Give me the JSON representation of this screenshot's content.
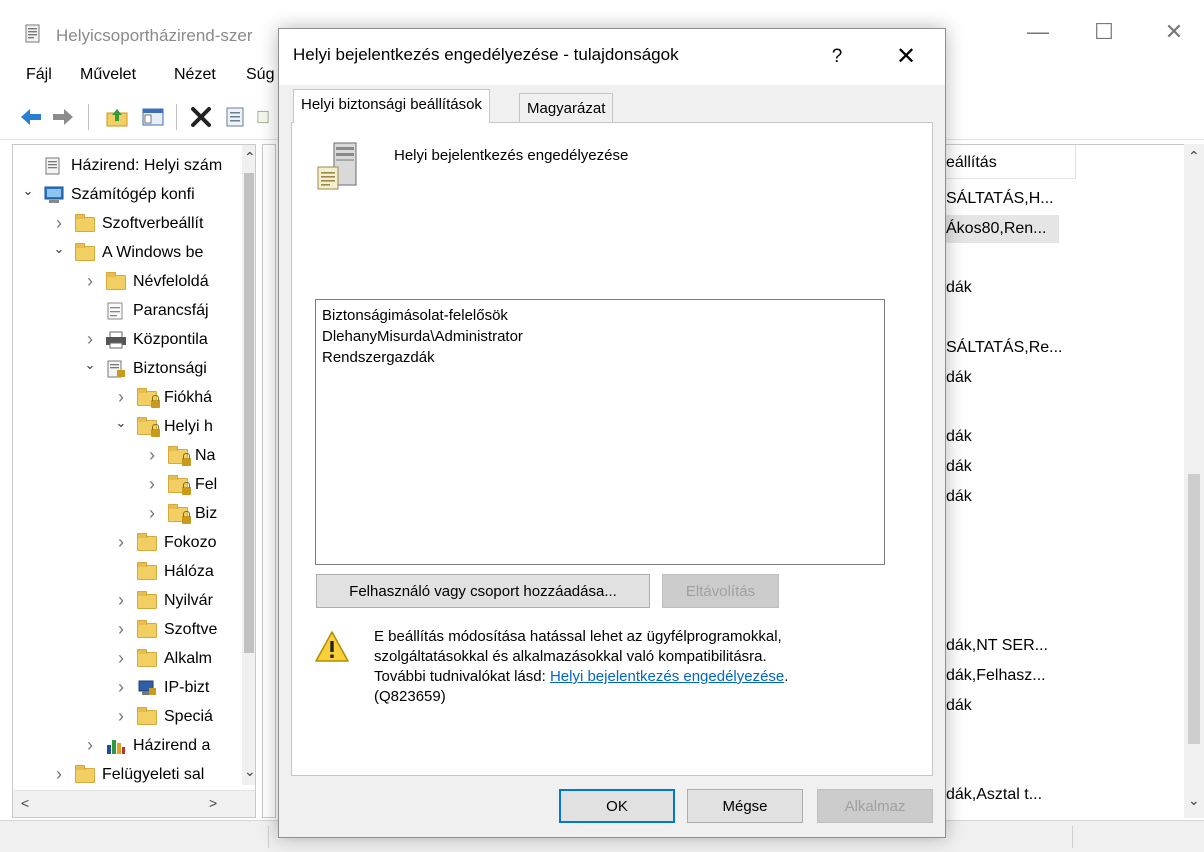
{
  "background_window": {
    "title": "Helyicsoportházirend-szer",
    "menu": [
      "Fájl",
      "Művelet",
      "Nézet",
      "Súg"
    ],
    "tree": [
      {
        "label": "Házirend: Helyi szám",
        "level": 0,
        "chevron": "",
        "icon": "policy-doc"
      },
      {
        "label": "Számítógép konfi",
        "level": 0,
        "chevron": "open",
        "icon": "computer"
      },
      {
        "label": "Szoftverbeállít",
        "level": 1,
        "chevron": "closed",
        "icon": "folder"
      },
      {
        "label": "A Windows be",
        "level": 1,
        "chevron": "open",
        "icon": "folder"
      },
      {
        "label": "Névfeloldá",
        "level": 2,
        "chevron": "closed",
        "icon": "folder"
      },
      {
        "label": "Parancsfáj",
        "level": 2,
        "chevron": "",
        "icon": "script"
      },
      {
        "label": "Központila",
        "level": 2,
        "chevron": "closed",
        "icon": "printer"
      },
      {
        "label": "Biztonsági",
        "level": 2,
        "chevron": "open",
        "icon": "security"
      },
      {
        "label": "Fiókhá",
        "level": 3,
        "chevron": "closed",
        "icon": "folder-lock"
      },
      {
        "label": "Helyi h",
        "level": 3,
        "chevron": "open",
        "icon": "folder-lock"
      },
      {
        "label": "Na",
        "level": 4,
        "chevron": "closed",
        "icon": "folder-lock"
      },
      {
        "label": "Fel",
        "level": 4,
        "chevron": "closed",
        "icon": "folder-lock"
      },
      {
        "label": "Biz",
        "level": 4,
        "chevron": "closed",
        "icon": "folder-lock"
      },
      {
        "label": "Fokozo",
        "level": 3,
        "chevron": "closed",
        "icon": "folder"
      },
      {
        "label": "Hálóza",
        "level": 3,
        "chevron": "",
        "icon": "folder"
      },
      {
        "label": "Nyilvár",
        "level": 3,
        "chevron": "closed",
        "icon": "folder"
      },
      {
        "label": "Szoftve",
        "level": 3,
        "chevron": "closed",
        "icon": "folder"
      },
      {
        "label": "Alkalm",
        "level": 3,
        "chevron": "closed",
        "icon": "folder"
      },
      {
        "label": "IP-bizt",
        "level": 3,
        "chevron": "closed",
        "icon": "ipsec"
      },
      {
        "label": "Speciá",
        "level": 3,
        "chevron": "closed",
        "icon": "folder"
      },
      {
        "label": "Házirend a",
        "level": 2,
        "chevron": "closed",
        "icon": "chart"
      },
      {
        "label": "Felügyeleti sal",
        "level": 1,
        "chevron": "closed",
        "icon": "folder"
      }
    ],
    "right_column_header": "eállítás",
    "right_column_values": [
      {
        "text": "SÁLTATÁS,H...",
        "selected": false
      },
      {
        "text": "Ákos80,Ren...",
        "selected": true
      },
      {
        "text": "",
        "selected": false
      },
      {
        "text": "dák",
        "selected": false
      },
      {
        "text": "",
        "selected": false
      },
      {
        "text": "SÁLTATÁS,Re...",
        "selected": false
      },
      {
        "text": "dák",
        "selected": false
      },
      {
        "text": "",
        "selected": false
      },
      {
        "text": "dák",
        "selected": false
      },
      {
        "text": "dák",
        "selected": false
      },
      {
        "text": "dák",
        "selected": false
      },
      {
        "text": "",
        "selected": false
      },
      {
        "text": "",
        "selected": false
      },
      {
        "text": "",
        "selected": false
      },
      {
        "text": "",
        "selected": false
      },
      {
        "text": "dák,NT SER...",
        "selected": false
      },
      {
        "text": "dák,Felhasz...",
        "selected": false
      },
      {
        "text": "dák",
        "selected": false
      },
      {
        "text": "",
        "selected": false
      },
      {
        "text": "",
        "selected": false
      },
      {
        "text": "dák,Asztal t...",
        "selected": false
      }
    ]
  },
  "dialog": {
    "title": "Helyi bejelentkezés engedélyezése - tulajdonságok",
    "help_label": "?",
    "close_label": "✕",
    "tabs": [
      "Helyi biztonsági beállítások",
      "Magyarázat"
    ],
    "policy_name": "Helyi bejelentkezés engedélyezése",
    "members": [
      "Biztonságimásolat-felelősök",
      "DlehanyMisurda\\Administrator",
      "Rendszergazdák"
    ],
    "add_button": "Felhasználó vagy csoport hozzáadása...",
    "remove_button": "Eltávolítás",
    "warning": {
      "line1": "E beállítás módosítása hatással lehet az ügyfélprogramokkal,",
      "line2": "szolgáltatásokkal és alkalmazásokkal való kompatibilitásra.",
      "line3_prefix": "További tudnivalókat lásd: ",
      "link": "Helyi bejelentkezés engedélyezése",
      "line3_suffix": ".",
      "line4": "(Q823659)"
    },
    "ok_button": "OK",
    "cancel_button": "Mégse",
    "apply_button": "Alkalmaz"
  },
  "colors": {
    "accent": "#0078d7",
    "link": "#0066cc",
    "folder": "#f2cf62"
  }
}
